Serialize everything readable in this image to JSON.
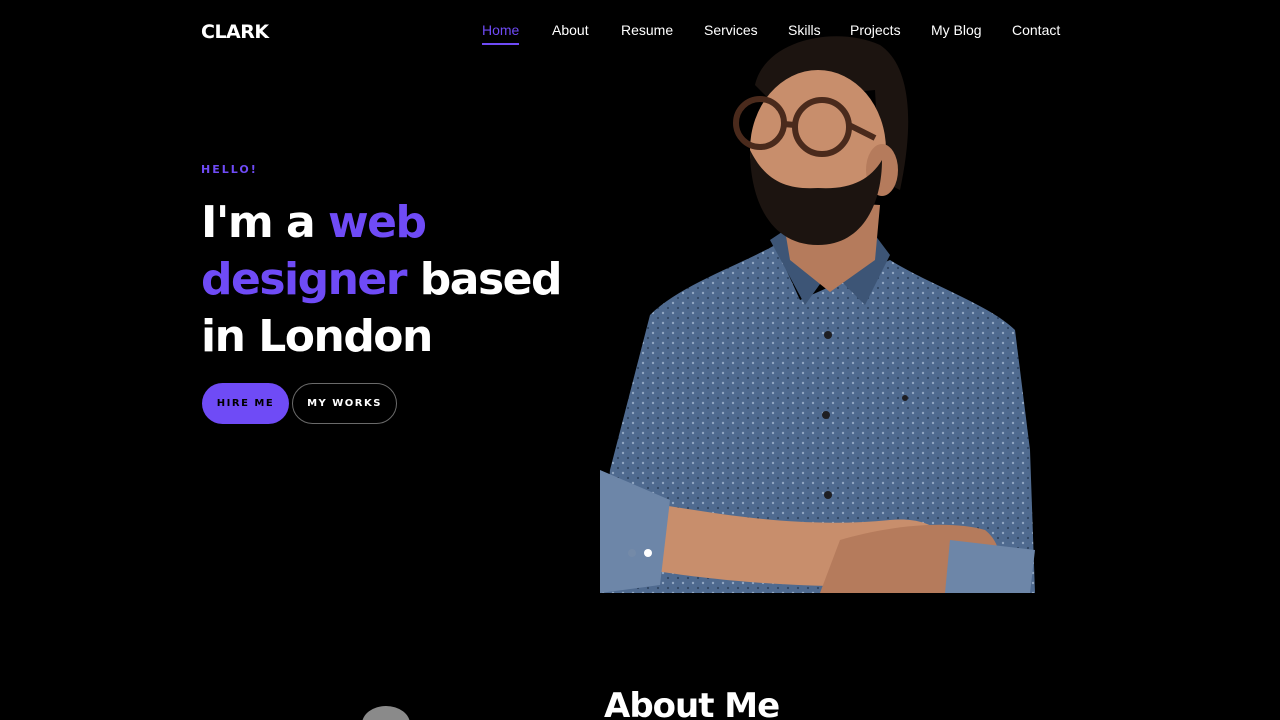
{
  "header": {
    "logo": "CLARK"
  },
  "nav": {
    "items": [
      {
        "label": "Home",
        "active": true
      },
      {
        "label": "About"
      },
      {
        "label": "Resume"
      },
      {
        "label": "Services"
      },
      {
        "label": "Skills"
      },
      {
        "label": "Projects"
      },
      {
        "label": "My Blog"
      },
      {
        "label": "Contact"
      }
    ]
  },
  "hero": {
    "eyebrow": "HELLO!",
    "headline": {
      "part1": "I'm a ",
      "accent1": "web",
      "accent2": "designer",
      "part2": " based",
      "part3": "in London"
    },
    "buttons": {
      "primary": "HIRE ME",
      "secondary": "MY WORKS"
    },
    "slider": {
      "count": 2,
      "active_index": 1
    }
  },
  "about": {
    "title": "About Me"
  },
  "colors": {
    "accent": "#6f4bf6",
    "background": "#000000",
    "text": "#ffffff"
  }
}
